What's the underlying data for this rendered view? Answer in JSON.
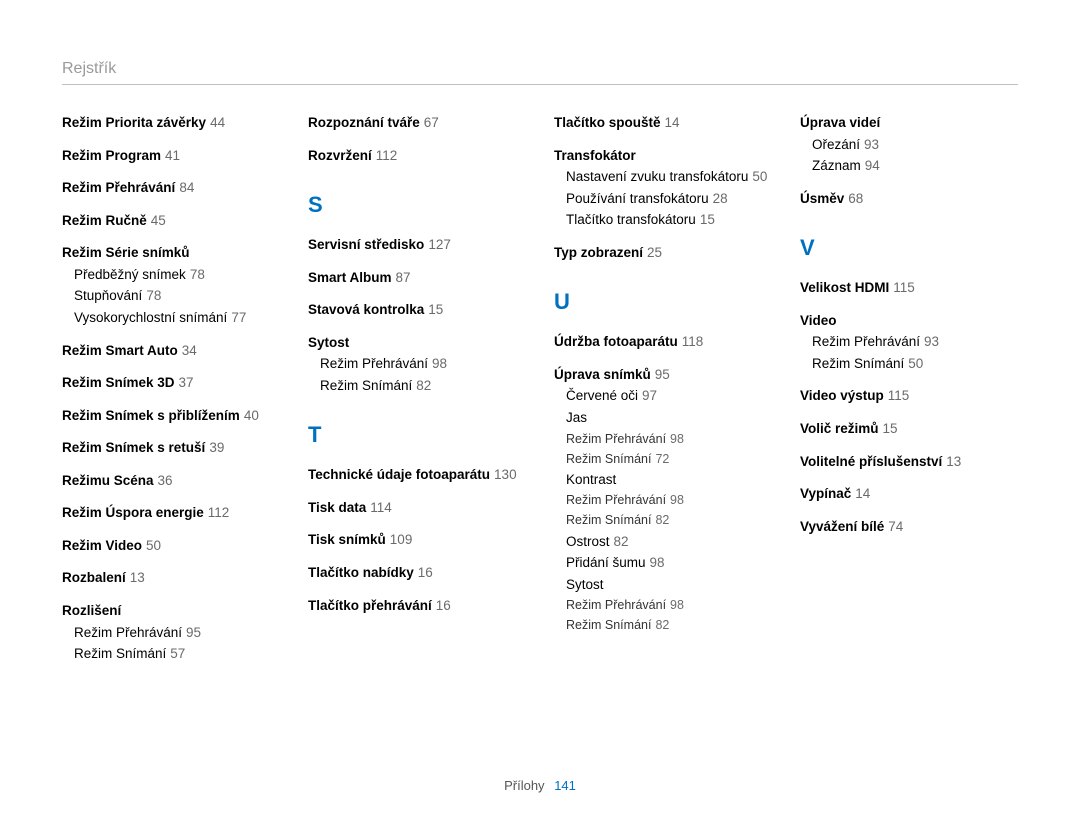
{
  "header": {
    "title": "Rejstřík"
  },
  "footer": {
    "label": "Přílohy",
    "page": "141"
  },
  "col1": [
    {
      "type": "entry",
      "term": "Režim Priorita závěrky",
      "page": "44"
    },
    {
      "type": "entry",
      "term": "Režim Program",
      "page": "41"
    },
    {
      "type": "entry",
      "term": "Režim Přehrávání",
      "page": "84"
    },
    {
      "type": "entry",
      "term": "Režim Ručně",
      "page": "45"
    },
    {
      "type": "entry",
      "term": "Režim Série snímků",
      "subs": [
        {
          "label": "Předběžný snímek",
          "page": "78"
        },
        {
          "label": "Stupňování",
          "page": "78"
        },
        {
          "label": "Vysokorychlostní snímání",
          "page": "77"
        }
      ]
    },
    {
      "type": "entry",
      "term": "Režim Smart Auto",
      "page": "34"
    },
    {
      "type": "entry",
      "term": "Režim Snímek 3D",
      "page": "37"
    },
    {
      "type": "entry",
      "term": "Režim Snímek s přiblížením",
      "page": "40"
    },
    {
      "type": "entry",
      "term": "Režim Snímek s retuší",
      "page": "39"
    },
    {
      "type": "entry",
      "term": "Režimu Scéna",
      "page": "36"
    },
    {
      "type": "entry",
      "term": "Režim Úspora energie",
      "page": "112"
    },
    {
      "type": "entry",
      "term": "Režim Video",
      "page": "50"
    },
    {
      "type": "entry",
      "term": "Rozbalení",
      "page": "13"
    },
    {
      "type": "entry",
      "term": "Rozlišení",
      "subs": [
        {
          "label": "Režim Přehrávání",
          "page": "95"
        },
        {
          "label": "Režim Snímání",
          "page": "57"
        }
      ]
    }
  ],
  "col2": [
    {
      "type": "entry",
      "term": "Rozpoznání tváře",
      "page": "67"
    },
    {
      "type": "entry",
      "term": "Rozvržení",
      "page": "112"
    },
    {
      "type": "letter",
      "text": "S"
    },
    {
      "type": "entry",
      "term": "Servisní středisko",
      "page": "127"
    },
    {
      "type": "entry",
      "term": "Smart Album",
      "page": "87"
    },
    {
      "type": "entry",
      "term": "Stavová kontrolka",
      "page": "15"
    },
    {
      "type": "entry",
      "term": "Sytost",
      "subs": [
        {
          "label": "Režim Přehrávání",
          "page": "98"
        },
        {
          "label": "Režim Snímání",
          "page": "82"
        }
      ]
    },
    {
      "type": "letter",
      "text": "T"
    },
    {
      "type": "entry",
      "term": "Technické údaje fotoaparátu",
      "page": "130"
    },
    {
      "type": "entry",
      "term": "Tisk data",
      "page": "114"
    },
    {
      "type": "entry",
      "term": "Tisk snímků",
      "page": "109"
    },
    {
      "type": "entry",
      "term": "Tlačítko nabídky",
      "page": "16"
    },
    {
      "type": "entry",
      "term": "Tlačítko přehrávání",
      "page": "16"
    }
  ],
  "col3": [
    {
      "type": "entry",
      "term": "Tlačítko spouště",
      "page": "14"
    },
    {
      "type": "entry",
      "term": "Transfokátor",
      "subs": [
        {
          "label": "Nastavení zvuku transfokátoru",
          "page": "50"
        },
        {
          "label": "Používání transfokátoru",
          "page": "28"
        },
        {
          "label": "Tlačítko transfokátoru",
          "page": "15"
        }
      ]
    },
    {
      "type": "entry",
      "term": "Typ zobrazení",
      "page": "25"
    },
    {
      "type": "letter",
      "text": "U"
    },
    {
      "type": "entry",
      "term": "Údržba fotoaparátu",
      "page": "118"
    },
    {
      "type": "entry",
      "term": "Úprava snímků",
      "page": "95",
      "subs": [
        {
          "label": "Červené oči",
          "page": "97"
        },
        {
          "label": "Jas",
          "subsubs": [
            {
              "label": "Režim Přehrávání",
              "page": "98"
            },
            {
              "label": "Režim Snímání",
              "page": "72"
            }
          ]
        },
        {
          "label": "Kontrast",
          "subsubs": [
            {
              "label": "Režim Přehrávání",
              "page": "98"
            },
            {
              "label": "Režim Snímání",
              "page": "82"
            }
          ]
        },
        {
          "label": "Ostrost",
          "page": "82"
        },
        {
          "label": "Přidání šumu",
          "page": "98"
        },
        {
          "label": "Sytost",
          "subsubs": [
            {
              "label": "Režim Přehrávání",
              "page": "98"
            },
            {
              "label": "Režim Snímání",
              "page": "82"
            }
          ]
        }
      ]
    }
  ],
  "col4": [
    {
      "type": "entry",
      "term": "Úprava videí",
      "subs": [
        {
          "label": "Ořezání",
          "page": "93"
        },
        {
          "label": "Záznam",
          "page": "94"
        }
      ]
    },
    {
      "type": "entry",
      "term": "Úsměv",
      "page": "68"
    },
    {
      "type": "letter",
      "text": "V"
    },
    {
      "type": "entry",
      "term": "Velikost HDMI",
      "page": "115"
    },
    {
      "type": "entry",
      "term": "Video",
      "subs": [
        {
          "label": "Režim Přehrávání",
          "page": "93"
        },
        {
          "label": "Režim Snímání",
          "page": "50"
        }
      ]
    },
    {
      "type": "entry",
      "term": "Video výstup",
      "page": "115"
    },
    {
      "type": "entry",
      "term": "Volič režimů",
      "page": "15"
    },
    {
      "type": "entry",
      "term": "Volitelné příslušenství",
      "page": "13"
    },
    {
      "type": "entry",
      "term": "Vypínač",
      "page": "14"
    },
    {
      "type": "entry",
      "term": "Vyvážení bílé",
      "page": "74"
    }
  ]
}
